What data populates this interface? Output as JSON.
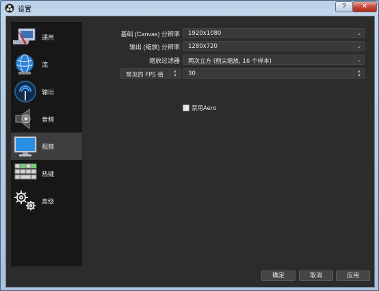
{
  "window": {
    "title": "设置",
    "help_glyph": "?",
    "close_glyph": "✕"
  },
  "sidebar": {
    "items": [
      {
        "label": "通用",
        "icon": "general-icon",
        "selected": false
      },
      {
        "label": "流",
        "icon": "stream-globe-icon",
        "selected": false
      },
      {
        "label": "输出",
        "icon": "output-antenna-icon",
        "selected": false
      },
      {
        "label": "音频",
        "icon": "speaker-icon",
        "selected": false
      },
      {
        "label": "视频",
        "icon": "monitor-icon",
        "selected": true
      },
      {
        "label": "热键",
        "icon": "keyboard-icon",
        "selected": false
      },
      {
        "label": "高级",
        "icon": "gears-icon",
        "selected": false
      }
    ]
  },
  "video": {
    "base_resolution": {
      "label": "基础 (Canvas) 分辨率",
      "value": "1920x1080"
    },
    "output_resolution": {
      "label": "输出 (缩放) 分辨率",
      "value": "1280x720"
    },
    "downscale_filter": {
      "label": "缩放过滤器",
      "value": "两次立方 (削尖缩放, 16 个样本)"
    },
    "fps": {
      "label": "常见的 FPS 值",
      "value": "30"
    },
    "disable_aero": {
      "label": "禁用Aero",
      "checked": false
    }
  },
  "buttons": {
    "ok": "确定",
    "cancel": "取消",
    "apply": "应用"
  }
}
